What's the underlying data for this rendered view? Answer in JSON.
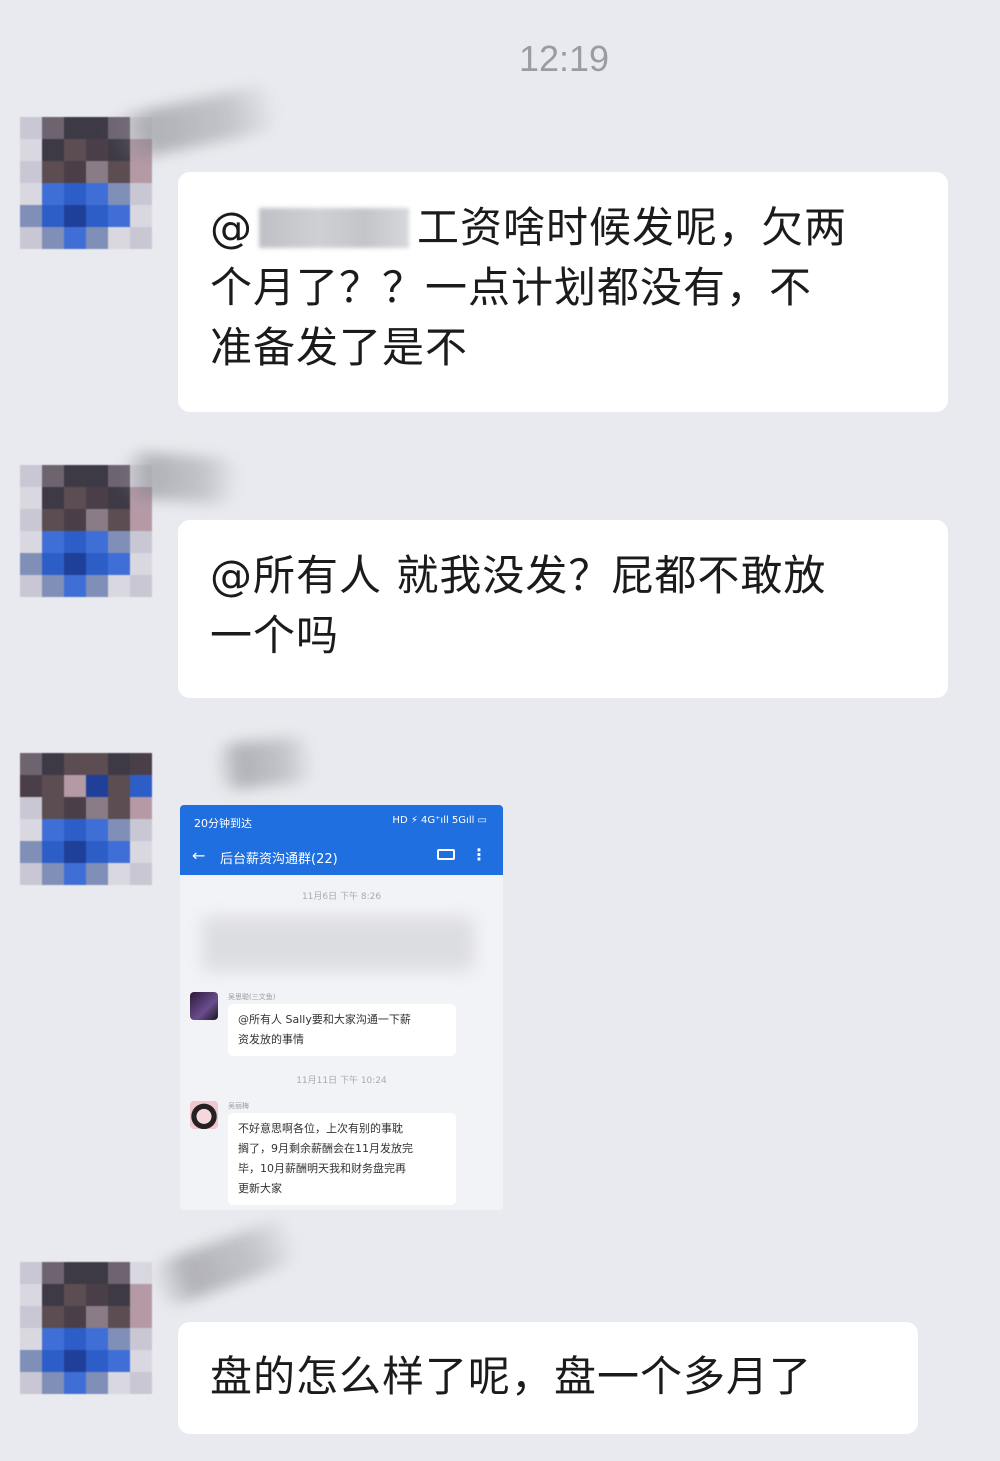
{
  "status": {
    "time": "12:19"
  },
  "messages": [
    {
      "type": "text",
      "prefix": "@",
      "line1_rest": "工资啥时候发呢，欠两",
      "line2": "个月了？？一点计划都没有，不",
      "line3": "准备发了是不"
    },
    {
      "type": "text",
      "line1": "@所有人 就我没发？屁都不敢放",
      "line2": "一个吗"
    },
    {
      "type": "image",
      "screenshot": {
        "status_left": "20分钟到达",
        "status_right": "HD ⚡ 4G⁺ıll 5Gıll ▭",
        "back_icon": "arrow-left-icon",
        "group_title": "后台薪资沟通群(22)",
        "timestamp1": "11月6日 下午 8:26",
        "sender1_name": "吴思聪(三文鱼)",
        "msg1_line1": "@所有人 Sally要和大家沟通一下薪",
        "msg1_line2": "资发放的事情",
        "timestamp2": "11月11日 下午 10:24",
        "sender2_name": "吴丽梅",
        "msg2_line1": "不好意思啊各位，上次有别的事耽",
        "msg2_line2": "搁了，9月剩余薪酬会在11月发放完",
        "msg2_line3": "毕，10月薪酬明天我和财务盘完再",
        "msg2_line4": "更新大家"
      }
    },
    {
      "type": "text",
      "line1": "盘的怎么样了呢，盘一个多月了"
    }
  ],
  "colors": {
    "background": "#e9eaef",
    "bubble": "#ffffff",
    "shot_header": "#1f6fe0"
  }
}
